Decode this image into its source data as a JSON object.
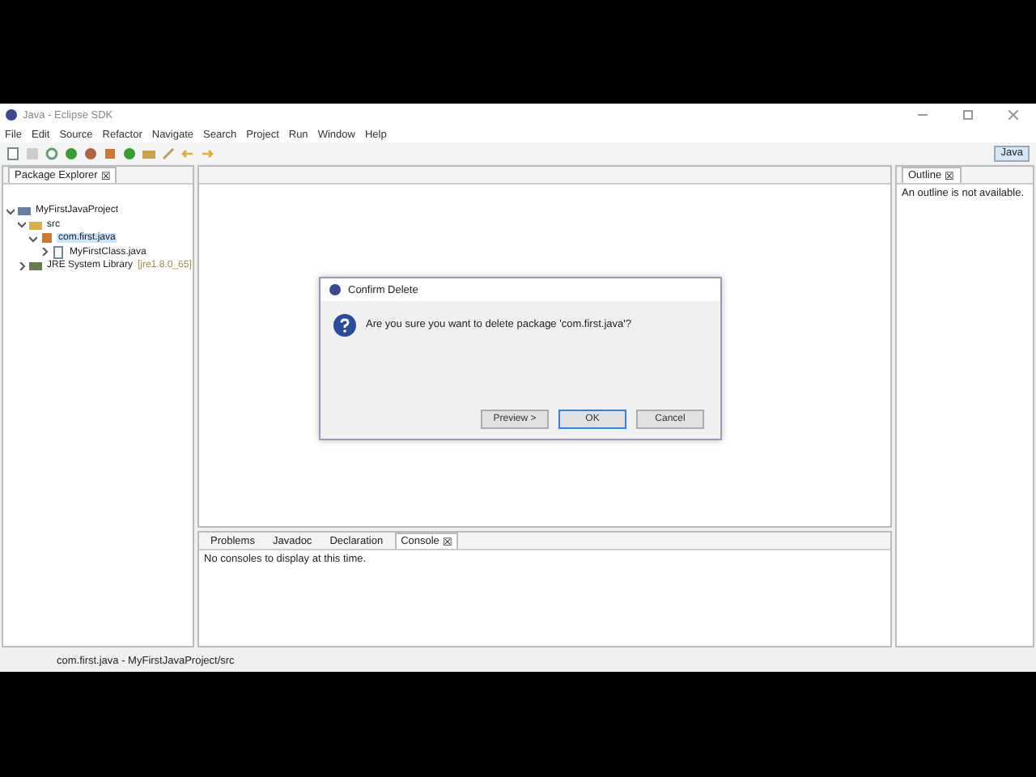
{
  "window": {
    "title": "Java - Eclipse SDK"
  },
  "menu": [
    "File",
    "Edit",
    "Source",
    "Refactor",
    "Navigate",
    "Search",
    "Project",
    "Run",
    "Window",
    "Help"
  ],
  "perspective": {
    "label": "Java",
    "selected": true
  },
  "package_explorer": {
    "title": "Package Explorer",
    "close": "☒",
    "tree": [
      {
        "label": "MyFirstJavaProject",
        "kind": "project",
        "expanded": true,
        "selected": false,
        "children": [
          {
            "label": "src",
            "kind": "folder",
            "expanded": true,
            "selected": false,
            "children": [
              {
                "label": "com.first.java",
                "kind": "package",
                "expanded": true,
                "selected": true,
                "children": [
                  {
                    "label": "MyFirstClass.java",
                    "kind": "file",
                    "expanded": false,
                    "selected": false
                  }
                ]
              }
            ]
          },
          {
            "label": "JRE System Library",
            "suffix": "[jre1.8.0_65]",
            "kind": "library",
            "expanded": false,
            "selected": false
          }
        ]
      }
    ]
  },
  "outline": {
    "title": "Outline",
    "close": "☒",
    "message": "An outline is not available."
  },
  "bottom_tabs": [
    {
      "label": "Problems",
      "selected": false
    },
    {
      "label": "Javadoc",
      "selected": false
    },
    {
      "label": "Declaration",
      "selected": false
    },
    {
      "label": "Console",
      "selected": true
    }
  ],
  "console": {
    "close": "☒",
    "message": "No consoles to display at this time."
  },
  "status_bar": "com.first.java - MyFirstJavaProject/src",
  "dialog": {
    "title": "Confirm Delete",
    "message": "Are you sure you want to delete package 'com.first.java'?",
    "buttons": [
      {
        "label": "Preview >",
        "selected": false
      },
      {
        "label": "OK",
        "selected": true
      },
      {
        "label": "Cancel",
        "selected": false
      }
    ]
  }
}
